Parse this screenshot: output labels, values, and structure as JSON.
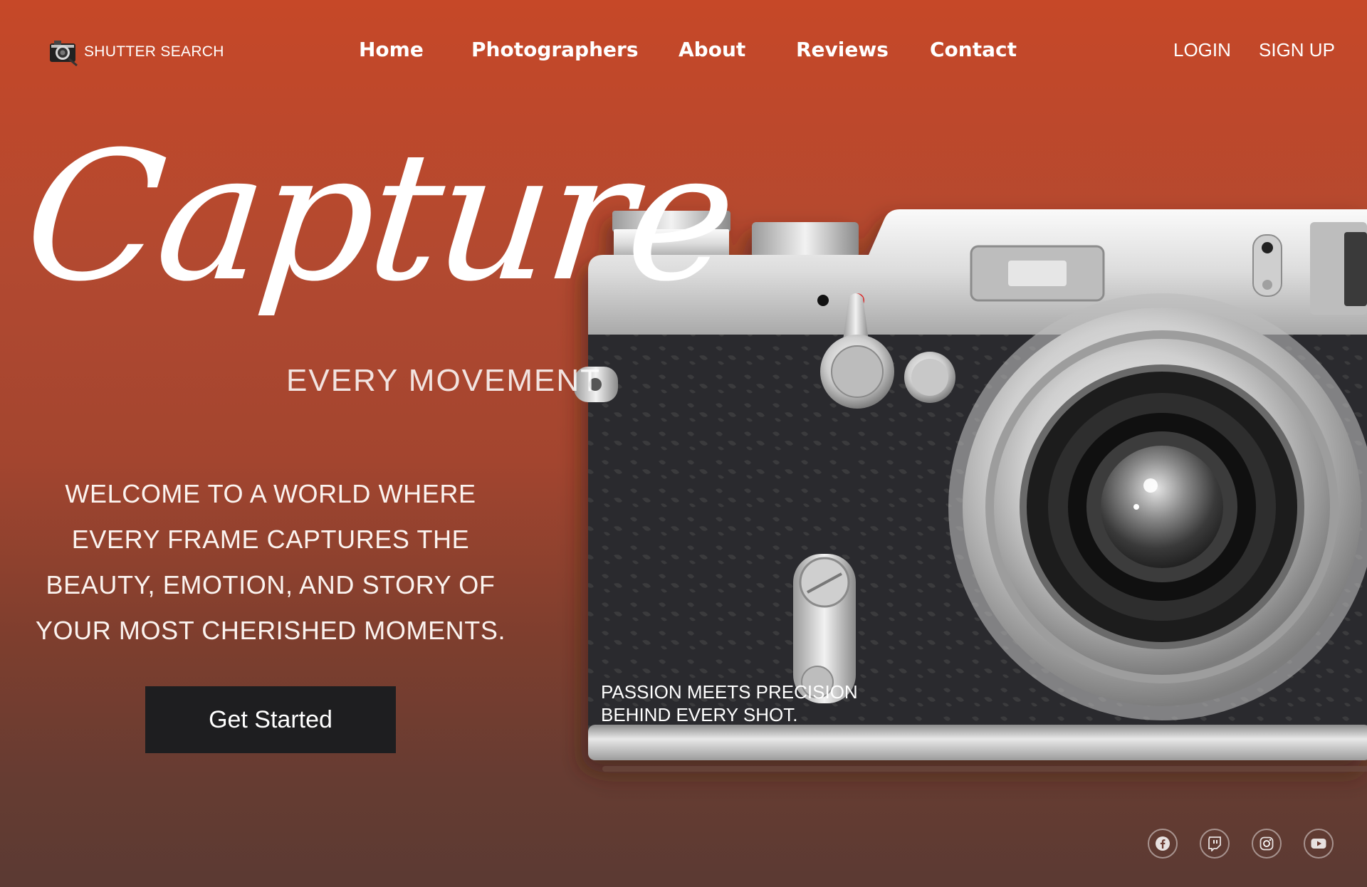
{
  "header": {
    "logo_text": "SHUTTER SEARCH",
    "logo_icon": "camera-search-icon",
    "nav": [
      {
        "label": "Home"
      },
      {
        "label": "Photographers"
      },
      {
        "label": "About"
      },
      {
        "label": "Reviews"
      },
      {
        "label": "Contact"
      }
    ],
    "login_label": "LOGIN",
    "signup_label": "SIGN UP"
  },
  "hero": {
    "script_title": "Capture",
    "subtitle": "EVERY MOVEMENT",
    "welcome_lines": [
      "WELCOME TO A WORLD WHERE",
      "EVERY FRAME CAPTURES THE",
      "BEAUTY, EMOTION, AND STORY OF",
      "YOUR MOST CHERISHED MOMENTS."
    ],
    "cta_label": "Get Started",
    "camera_caption_lines": [
      "PASSION MEETS PRECISION",
      "BEHIND EVERY SHOT."
    ]
  },
  "social": [
    {
      "icon": "facebook-icon"
    },
    {
      "icon": "twitch-icon"
    },
    {
      "icon": "instagram-icon"
    },
    {
      "icon": "youtube-icon"
    }
  ],
  "colors": {
    "background_top": "#c64828",
    "background_bottom": "#5b3a33",
    "button": "#1e1e20",
    "camera_body": "#2a2a2c",
    "camera_silver": "#d6d6d6"
  }
}
